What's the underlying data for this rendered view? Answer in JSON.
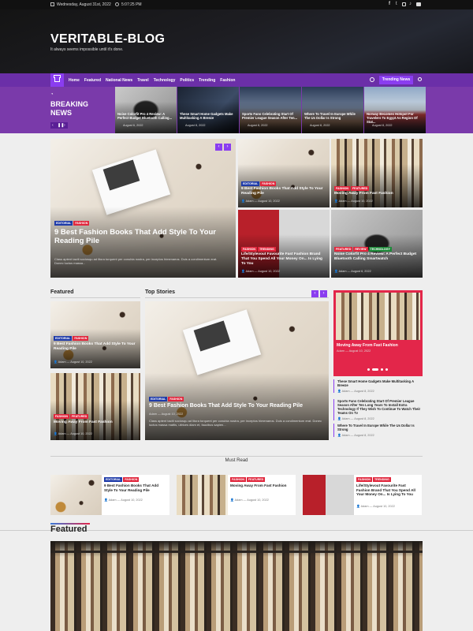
{
  "topbar": {
    "date": "Wednesday, August 31st, 2022",
    "time": "5:07:25 PM"
  },
  "brand": {
    "title": "VERITABLE-BLOG",
    "tagline": "It always seems impossible until it's done."
  },
  "nav": {
    "items": [
      "Home",
      "Featured",
      "National News",
      "Travel",
      "Technology",
      "Politics",
      "Trending",
      "Fashion"
    ],
    "trending_btn": "Trending News"
  },
  "breaking": {
    "label_1": "BREAKING",
    "label_2": "NEWS",
    "items": [
      {
        "title": "Noise Colorfit Pro 4 Review: A Perfect Budget Bluetooth Calling...",
        "date": "August 6, 2022"
      },
      {
        "title": "These Smart Home Gadgets Make Multitasking A Breeze",
        "date": "August 8, 2022"
      },
      {
        "title": "Sports Fans Celebrating Start Of Premier League Season After Ten...",
        "date": "August 8, 2022"
      },
      {
        "title": "Where To Travel In Europe While The Us Dollar Is Strong",
        "date": "August 8, 2022"
      },
      {
        "title": "Norway Becomes Hotspot For Travelers To Egypt As Region Of Stat...",
        "date": "August 8, 2022"
      }
    ]
  },
  "hero": {
    "tags": [
      "EDITORIAL",
      "FASHION"
    ],
    "title": "9 Best Fashion Books That Add Style To Your Reading Pile",
    "excerpt": "Class aptent taciti sociosqu ad litora torquent per conubia nostra, per inceptos himenaeos. Duis a condimentum erat. Donec luctus massa..."
  },
  "grid": [
    {
      "tags": [
        "EDITORIAL",
        "FASHION"
      ],
      "title": "9 Best Fashion Books That Add Style To Your Reading Pile",
      "author": "Adam",
      "date": "August 10, 2022"
    },
    {
      "tags": [
        "FASHION",
        "FEATURED"
      ],
      "title": "Moving Away From Fast Fashion",
      "author": "Adam",
      "date": "August 10, 2022"
    },
    {
      "tags": [
        "FASHION",
        "TRENDING"
      ],
      "title": "Life/Stylevout Favourite Fast Fashion Brand That You Spend All Your Money On... Is Lying To You",
      "author": "Adam",
      "date": "August 10, 2022"
    },
    {
      "tags": [
        "FEATURED",
        "REVIEW",
        "TECHNOLOGY"
      ],
      "title": "Noise Colorfit Pro 4 Review: A Perfect Budget Bluetooth Calling Smartwatch",
      "author": "Adam",
      "date": "August 6, 2022"
    }
  ],
  "featured": {
    "heading": "Featured",
    "items": [
      {
        "tags": [
          "EDITORIAL",
          "FASHION"
        ],
        "title": "9 Best Fashion Books That Add Style To Your Reading Pile",
        "author": "Adam",
        "date": "August 10, 2022"
      },
      {
        "tags": [
          "FASHION",
          "FEATURED"
        ],
        "title": "Moving Away From Fast Fashion",
        "author": "Adam",
        "date": "August 10, 2022"
      }
    ]
  },
  "top_stories": {
    "heading": "Top Stories",
    "tags": [
      "EDITORIAL",
      "FASHION"
    ],
    "title": "9 Best Fashion Books That Add Style To Your Reading Pile",
    "author": "Adam",
    "date": "August 10, 2022",
    "excerpt": "Class aptent taciti sociosqu ad litora torquent per conubia nostra, per inceptos himenaeos. Duis a condimentum erat. Donec luctus massa mattis, ultrices diam et, faucibus sapien..."
  },
  "side": {
    "card": {
      "title": "Moving Away From Fast Fashion",
      "author": "Adam",
      "date": "August 10, 2022"
    },
    "list": [
      {
        "title": "These Smart Home Gadgets Make Multitasking A Breeze",
        "author": "Adam",
        "date": "August 8, 2022"
      },
      {
        "title": "Sports Fans Celebrating Start Of Premier League Season After Ten Long Years To Install Extra Technology If They Wish To Continue To Watch Their Teams On Tv",
        "author": "Adam",
        "date": "August 8, 2022"
      },
      {
        "title": "Where To Travel In Europe While The Us Dollar Is Strong",
        "author": "Adam",
        "date": "August 8, 2022"
      }
    ]
  },
  "must_read": {
    "heading": "Must Read",
    "items": [
      {
        "tags": [
          "EDITORIAL",
          "FASHION"
        ],
        "title": "9 Best Fashion Books That Add Style To Your Reading Pile",
        "author": "Adam",
        "date": "August 10, 2022"
      },
      {
        "tags": [
          "FASHION",
          "FEATURED"
        ],
        "title": "Moving Away From Fast Fashion",
        "author": "Adam",
        "date": "August 10, 2022"
      },
      {
        "tags": [
          "FASHION",
          "TRENDING"
        ],
        "title": "Life/Stylevout Favourite Fast Fashion Brand That You Spend All Your Money On... Is Lying To You",
        "author": "Adam",
        "date": "August 10, 2022"
      }
    ]
  },
  "featured_bottom": {
    "heading": "Featured"
  },
  "colors": {
    "accent": "#7a2bd6",
    "nav_bg": "#6b2fa8",
    "topbar": "#111111"
  }
}
